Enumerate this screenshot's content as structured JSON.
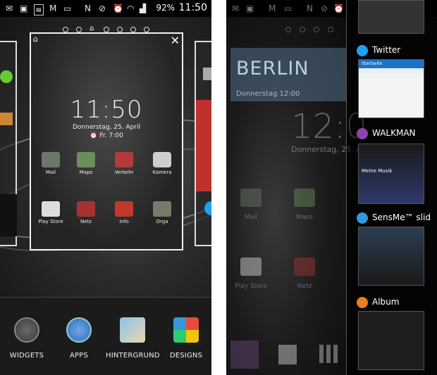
{
  "status_bar": {
    "icons": [
      "mail-icon",
      "image-icon",
      "sd-card-icon",
      "gmail-icon",
      "chat-icon",
      "nfc-icon",
      "no-sound-icon",
      "alarm-icon",
      "wifi-icon",
      "signal-icon"
    ],
    "battery_text": "92%",
    "time": "11:50"
  },
  "preview": {
    "clock_time": "11:50",
    "clock_date": "Donnerstag, 25. April",
    "alarm": "Fr. 7:00",
    "apps": [
      {
        "label": "Mail",
        "color": "#6a7a6a"
      },
      {
        "label": "Maps",
        "color": "#6b8e5a"
      },
      {
        "label": "Verkehr",
        "color": "#b53b3b"
      },
      {
        "label": "Kamera",
        "color": "#cfcfcf"
      },
      {
        "label": "Play Store",
        "color": "#dddddd"
      },
      {
        "label": "Netz",
        "color": "#a83232"
      },
      {
        "label": "Info",
        "color": "#c0392b"
      },
      {
        "label": "Orga",
        "color": "#7a7a6a"
      }
    ]
  },
  "dock": {
    "items": [
      {
        "label": "WIDGETS"
      },
      {
        "label": "APPS"
      },
      {
        "label": "HINTERGRUND"
      },
      {
        "label": "DESIGNS"
      }
    ]
  },
  "right_home": {
    "city": "BERLIN",
    "weather_date": "Donnerstag 12:00",
    "clock_time": "12:0",
    "clock_date": "Donnerstag, 25. A",
    "apps": [
      {
        "label": "Mail"
      },
      {
        "label": "Maps"
      },
      {
        "label": "Play Store"
      },
      {
        "label": "Netz"
      }
    ]
  },
  "recent_apps": [
    {
      "title": "Twitter",
      "color": "#1da1f2"
    },
    {
      "title": "WALKMAN",
      "color": "#8e44ad"
    },
    {
      "title": "SensMe™ slid",
      "color": "#3498db"
    },
    {
      "title": "Album",
      "color": "#e67e22"
    }
  ],
  "twitter_thumb": {
    "header": "Startseite"
  },
  "walkman_thumb": {
    "header": "Meine Musik"
  }
}
